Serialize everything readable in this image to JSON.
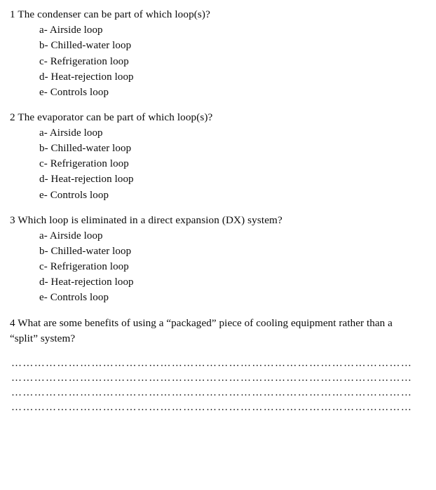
{
  "document": {
    "questions": [
      {
        "number": "1",
        "text": "1 The condenser can be part of which loop(s)?",
        "options": [
          "a- Airside loop",
          "b- Chilled-water loop",
          "c- Refrigeration loop",
          "d- Heat-rejection loop",
          "e- Controls loop"
        ]
      },
      {
        "number": "2",
        "text": "2 The evaporator can be part of which loop(s)?",
        "options": [
          "a- Airside loop",
          "b- Chilled-water loop",
          "c- Refrigeration loop",
          "d- Heat-rejection loop",
          "e- Controls loop"
        ]
      },
      {
        "number": "3",
        "text": "3 Which loop is eliminated in a direct expansion (DX) system?",
        "options": [
          "a- Airside loop",
          "b- Chilled-water loop",
          "c- Refrigeration loop",
          "d- Heat-rejection loop",
          "e- Controls loop"
        ]
      }
    ],
    "open_question": {
      "number": "4",
      "text": "4 What are some benefits of using a “packaged” piece of cooling equipment rather than a “split” system?",
      "answer_lines": [
        "……………………………………………………………………………………………",
        "……………………………………………………………………………………………",
        "……………………………………………………………………………………………",
        "……………………………………………………………………………………………"
      ]
    }
  }
}
